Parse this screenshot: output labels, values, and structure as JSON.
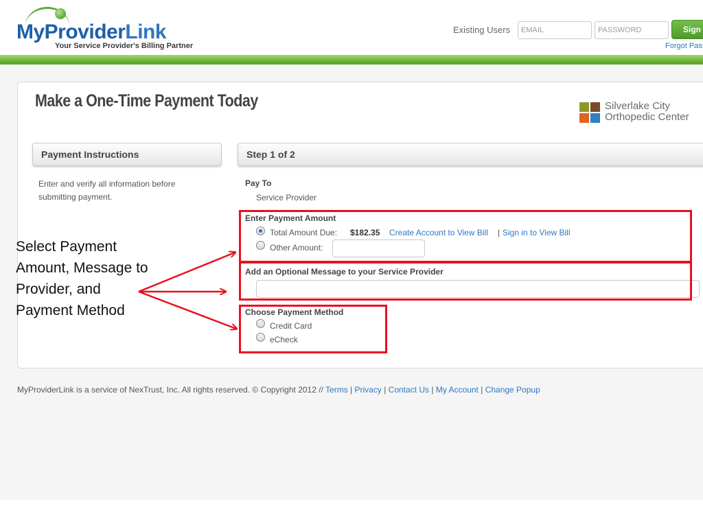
{
  "brand": {
    "logo_text_a": "MyProvider",
    "logo_text_b": "Link",
    "tagline": "Your Service Provider's Billing Partner"
  },
  "login": {
    "label": "Existing Users",
    "email_placeholder": "EMAIL",
    "password_placeholder": "PASSWORD",
    "signin_label": "Sign",
    "forgot_label": "Forgot Pass"
  },
  "page": {
    "title": "Make a One-Time Payment Today",
    "provider_line1": "Silverlake City",
    "provider_line2": "Orthopedic Center"
  },
  "instructions": {
    "header": "Payment Instructions",
    "text": "Enter and verify all information before submitting payment."
  },
  "step": {
    "header": "Step 1 of 2",
    "pay_to_label": "Pay To",
    "pay_to_value": "Service Provider",
    "amount_label": "Enter Payment Amount",
    "total_due_label": "Total Amount Due:",
    "total_due_value": "$182.35",
    "create_account_link": "Create Account to View Bill",
    "separator": "|",
    "sign_in_link": "Sign in to View Bill",
    "other_amount_label": "Other Amount:",
    "message_label": "Add an Optional Message to your Service Provider",
    "method_label": "Choose Payment Method",
    "method_options": [
      "Credit Card",
      "eCheck"
    ]
  },
  "footer": {
    "text": "MyProviderLink is a service of NexTrust, Inc. All rights reserved. © Copyright 2012 //",
    "links": [
      "Terms",
      "Privacy",
      "Contact Us",
      "My Account",
      "Change Popup"
    ],
    "separator": "|"
  },
  "annotation": {
    "lines": [
      "Select Payment",
      "Amount, Message to",
      "Provider, and",
      "Payment Method"
    ],
    "color": "#e8101f"
  },
  "colors": {
    "brand_blue": "#1f5fa8",
    "brand_green": "#5aa83a",
    "link_blue": "#2f76c3",
    "highlight_red": "#e8101f",
    "logo_squares": [
      "#8a9a2a",
      "#7a4a2a",
      "#e0651f",
      "#2f7fc3"
    ]
  }
}
